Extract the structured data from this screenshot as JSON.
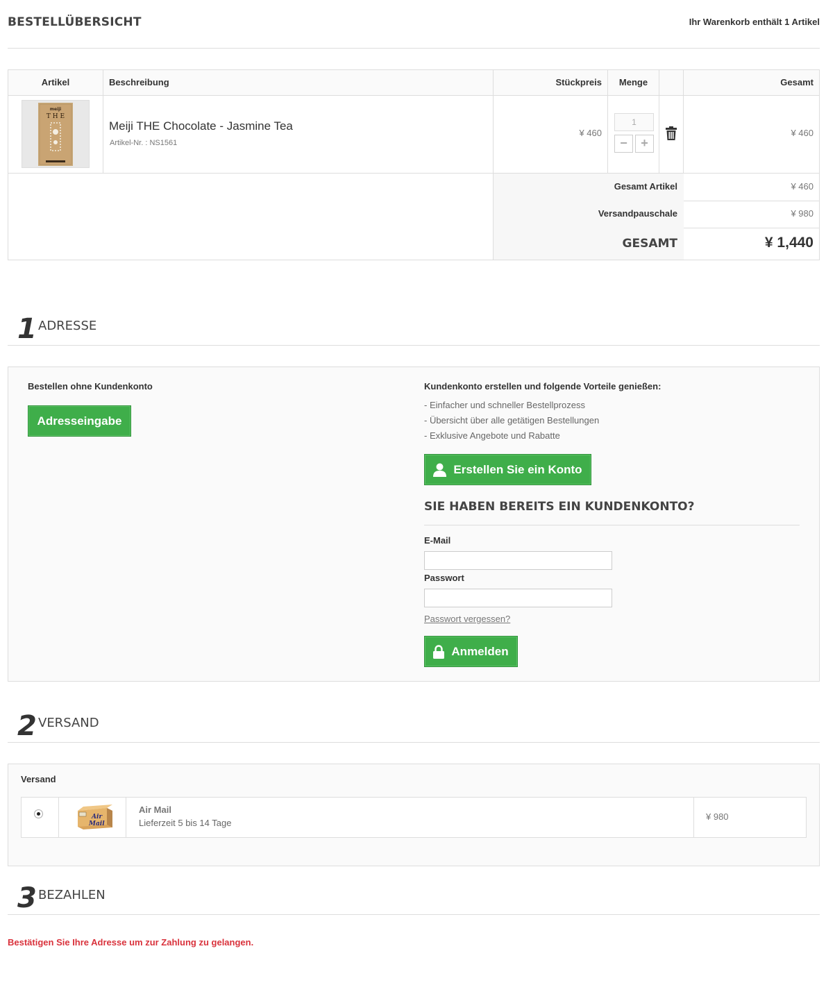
{
  "header": {
    "title": "BESTELLÜBERSICHT",
    "cart_info": "Ihr Warenkorb enthält 1 Artikel"
  },
  "cart": {
    "columns": {
      "article": "Artikel",
      "description": "Beschreibung",
      "unit_price": "Stückpreis",
      "quantity": "Menge",
      "total": "Gesamt"
    },
    "item": {
      "name": "Meiji THE Chocolate - Jasmine Tea",
      "sku": "Artikel-Nr. : NS1561",
      "unit_price": "¥ 460",
      "quantity": "1",
      "total": "¥ 460",
      "minus": "−",
      "plus": "+"
    },
    "summary": {
      "items_label": "Gesamt Artikel",
      "items_value": "¥ 460",
      "shipping_label": "Versandpauschale",
      "shipping_value": "¥ 980",
      "grand_label": "GESAMT",
      "grand_value": "¥ 1,440"
    }
  },
  "address": {
    "num": "1",
    "title": "ADRESSE",
    "guest_label": "Bestellen ohne Kundenkonto",
    "guest_button": "Adresseingabe",
    "benefits_title": "Kundenkonto erstellen und folgende Vorteile genießen:",
    "benefits": [
      "- Einfacher und schneller Bestellprozess",
      "- Übersicht über alle getätigen Bestellungen",
      "- Exklusive Angebote und Rabatte"
    ],
    "create_button": "Erstellen Sie ein Konto",
    "login_title": "SIE HABEN BEREITS EIN KUNDENKONTO?",
    "email_label": "E-Mail",
    "password_label": "Passwort",
    "forgot_link": "Passwort vergessen?",
    "login_button": "Anmelden"
  },
  "shipping": {
    "num": "2",
    "title": "VERSAND",
    "label": "Versand",
    "option": {
      "name": "Air Mail",
      "delivery": "Lieferzeit 5 bis 14 Tage",
      "price": "¥ 980",
      "box_text_1": "Air",
      "box_text_2": "Mail"
    }
  },
  "payment": {
    "num": "3",
    "title": "BEZAHLEN",
    "message": "Bestätigen Sie Ihre Adresse um zur Zahlung zu gelangen."
  }
}
